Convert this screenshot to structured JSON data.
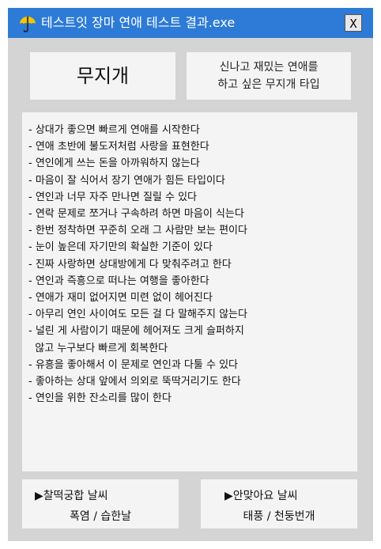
{
  "window": {
    "title": "테스트잇 장마 연애 테스트 결과.exe",
    "close_label": "X"
  },
  "result": {
    "type_name": "무지개",
    "description_line1": "신나고 재밌는 연애를",
    "description_line2": "하고 싶은 무지개 타입"
  },
  "traits": [
    "- 상대가 좋으면 빠르게 연애를 시작한다",
    "- 연애 초반에 불도저처럼 사랑을 표현한다",
    "- 연인에게 쓰는 돈을 아까워하지 않는다",
    "- 마음이 잘 식어서 장기 연애가 힘든 타입이다",
    "- 연인과 너무 자주 만나면 질릴 수 있다",
    "- 연락 문제로 쪼거나 구속하려 하면 마음이 식는다",
    "- 한번 정착하면 꾸준히 오래 그 사람만 보는 편이다",
    "- 눈이 높은데 자기만의 확실한 기준이 있다",
    "- 진짜 사랑하면 상대방에게 다 맞춰주려고 한다",
    "- 연인과 즉흥으로 떠나는 여행을 좋아한다",
    "- 연애가 재미 없어지면 미련 없이 헤어진다",
    "- 아무리 연인 사이여도 모든 걸 다 말해주지 않는다",
    "- 널린 게 사람이기 때문에 헤어져도 크게 슬퍼하지",
    "  않고 누구보다 빠르게 회복한다",
    "- 유흥을 좋아해서 이 문제로 연인과 다툴 수 있다",
    "- 좋아하는 상대 앞에서 의외로 뚝딱거리기도 한다",
    "- 연인을 위한 잔소리를 많이 한다"
  ],
  "match": {
    "good_label": "▶찰떡궁합 날씨",
    "good_value": "폭염 / 습한날",
    "bad_label": "▶안맞아요 날씨",
    "bad_value": "태풍 / 천둥번개"
  },
  "colors": {
    "titlebar": "#2d7bd6",
    "window_bg": "#d4d4d4",
    "panel_bg": "#f4f4f4",
    "umbrella": "#f5c400"
  },
  "icons": {
    "title_icon": "umbrella-icon"
  }
}
